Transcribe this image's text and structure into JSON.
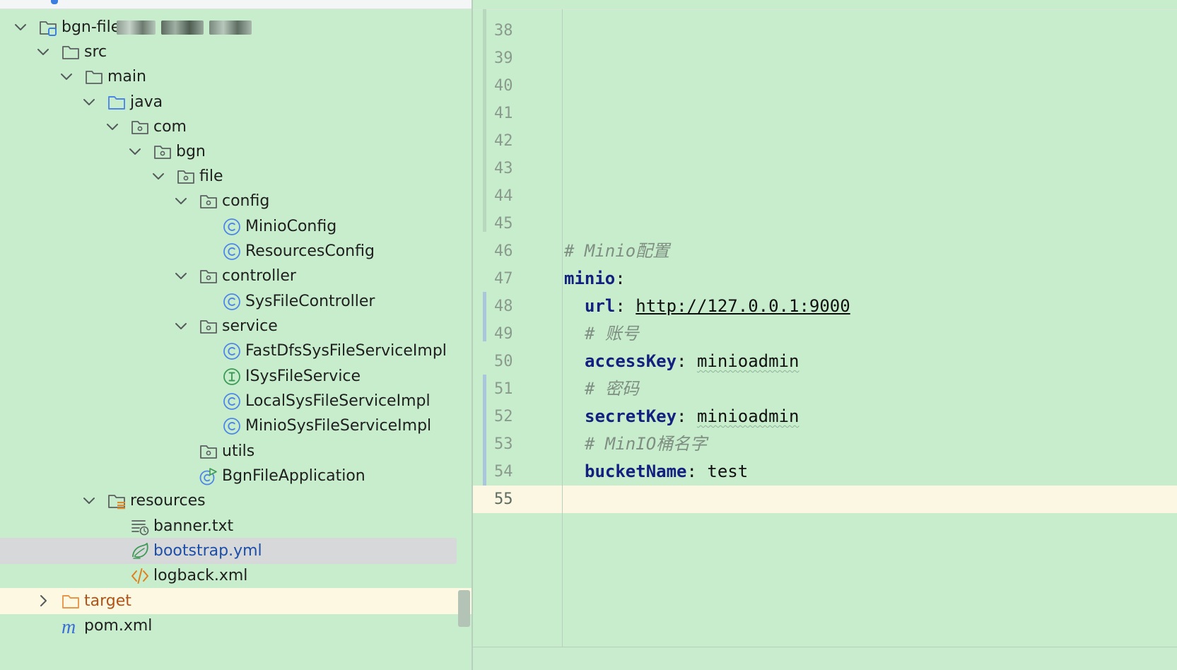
{
  "project_tree": {
    "root": "bgn-file",
    "items": [
      {
        "label": "bgn-file"
      },
      {
        "label": "src"
      },
      {
        "label": "main"
      },
      {
        "label": "java"
      },
      {
        "label": "com"
      },
      {
        "label": "bgn"
      },
      {
        "label": "file"
      },
      {
        "label": "config"
      },
      {
        "label": "MinioConfig"
      },
      {
        "label": "ResourcesConfig"
      },
      {
        "label": "controller"
      },
      {
        "label": "SysFileController"
      },
      {
        "label": "service"
      },
      {
        "label": "FastDfsSysFileServiceImpl"
      },
      {
        "label": "ISysFileService"
      },
      {
        "label": "LocalSysFileServiceImpl"
      },
      {
        "label": "MinioSysFileServiceImpl"
      },
      {
        "label": "utils"
      },
      {
        "label": "BgnFileApplication"
      },
      {
        "label": "resources"
      },
      {
        "label": "banner.txt"
      },
      {
        "label": "bootstrap.yml"
      },
      {
        "label": "logback.xml"
      },
      {
        "label": "target"
      },
      {
        "label": "pom.xml"
      }
    ]
  },
  "editor": {
    "file": "bootstrap.yml",
    "line_numbers": [
      "38",
      "39",
      "40",
      "41",
      "42",
      "43",
      "44",
      "45",
      "46",
      "47",
      "48",
      "49",
      "50",
      "51",
      "52",
      "53",
      "54",
      "55"
    ],
    "lines": {
      "l46_comment": "# Minio配置",
      "l47_key": "minio",
      "l48_key": "url",
      "l48_value": "http://127.0.0.1:9000",
      "l49_comment": "# 账号",
      "l50_key": "accessKey",
      "l50_value": "minioadmin",
      "l51_comment": "# 密码",
      "l52_key": "secretKey",
      "l52_value": "minioadmin",
      "l53_comment": "# MinIO桶名字",
      "l54_key": "bucketName",
      "l54_value": "test"
    },
    "colon": ":",
    "current_line": "55"
  },
  "colors": {
    "background": "#c7edcc",
    "selection": "#d6d8d9",
    "current_line": "#fcf7e3",
    "yaml_key": "#14207f",
    "comment": "#7f8e82",
    "folder_outline": "#5d6062",
    "java_folder": "#4e86e8",
    "class_icon": "#4e86e8",
    "interface_icon": "#3c9a55",
    "excluded_folder": "#e8964c"
  },
  "icons": {
    "chevron_down": "chevron-down-icon",
    "chevron_right": "chevron-right-icon",
    "module": "module-folder-icon",
    "folder": "folder-icon",
    "source_folder": "source-root-folder-icon",
    "package": "package-icon",
    "class": "class-icon",
    "interface": "interface-icon",
    "spring_boot": "spring-boot-app-icon",
    "resources": "resources-folder-icon",
    "text_file": "text-file-icon",
    "yaml_file": "spring-yaml-icon",
    "xml_file": "xml-file-icon",
    "excluded_folder": "excluded-folder-icon",
    "maven": "maven-icon"
  }
}
